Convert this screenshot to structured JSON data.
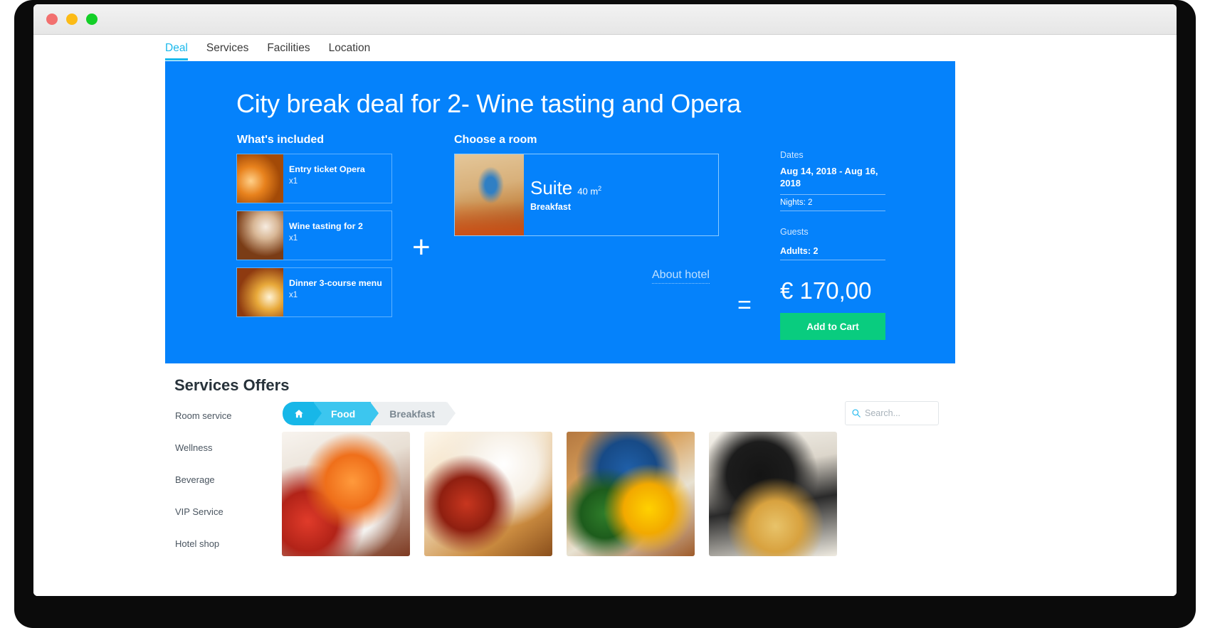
{
  "window": {
    "traffic_lights": [
      {
        "name": "close",
        "color": "#f2706f"
      },
      {
        "name": "minimize",
        "color": "#fcbb16"
      },
      {
        "name": "zoom",
        "color": "#13cf27"
      }
    ]
  },
  "topnav": {
    "tabs": [
      {
        "label": "Deal",
        "active": true
      },
      {
        "label": "Services",
        "active": false
      },
      {
        "label": "Facilities",
        "active": false
      },
      {
        "label": "Location",
        "active": false
      }
    ]
  },
  "deal": {
    "title": "City break deal for 2- Wine tasting and Opera",
    "included_heading": "What's included",
    "room_heading": "Choose a room",
    "plus_symbol": "+",
    "equals_symbol": "=",
    "included": [
      {
        "name": "Entry ticket Opera",
        "qty": "x1"
      },
      {
        "name": "Wine tasting for 2",
        "qty": "x1"
      },
      {
        "name": "Dinner 3-course menu",
        "qty": "x1"
      }
    ],
    "room": {
      "name": "Suite",
      "size": "40 m",
      "size_exponent": "2",
      "meal": "Breakfast"
    },
    "about_hotel_link": "About hotel",
    "summary": {
      "dates_label": "Dates",
      "dates_value": "Aug 14, 2018 - Aug 16, 2018",
      "nights": "Nights: 2",
      "guests_label": "Guests",
      "adults": "Adults: 2"
    },
    "price": "€ 170,00",
    "add_to_cart_label": "Add to Cart",
    "colors": {
      "panel_blue": "#0582fb",
      "cart_green": "#09cc7f",
      "accent_cyan": "#1ab9ec"
    }
  },
  "services": {
    "title": "Services Offers",
    "sidebar": [
      {
        "label": "Room service"
      },
      {
        "label": "Wellness"
      },
      {
        "label": "Beverage"
      },
      {
        "label": "VIP Service"
      },
      {
        "label": "Hotel shop"
      }
    ],
    "breadcrumb": [
      {
        "label": "",
        "icon": "home-icon",
        "style": "home"
      },
      {
        "label": "Food",
        "style": "food"
      },
      {
        "label": "Breakfast",
        "style": "plain"
      }
    ],
    "search": {
      "placeholder": "Search...",
      "value": "",
      "icon": "search-icon"
    },
    "cards": [
      {
        "name": "food-card-fruit-bowl"
      },
      {
        "name": "food-card-breakfast-table"
      },
      {
        "name": "food-card-eggs-dish"
      },
      {
        "name": "food-card-pancakes"
      }
    ]
  }
}
